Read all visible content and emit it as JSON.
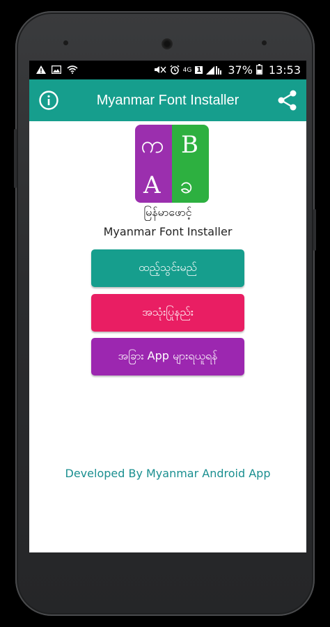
{
  "status_bar": {
    "battery_percent": "37%",
    "time": "13:53",
    "network_type": "4G",
    "sim_slot": "1",
    "icons": [
      "warning-icon",
      "image-icon",
      "wifi-icon",
      "mute-icon",
      "alarm-icon",
      "signal-icon",
      "battery-icon"
    ]
  },
  "app_bar": {
    "title": "Myanmar Font Installer",
    "left_icon": "info-icon",
    "right_icon": "share-icon",
    "color": "#169e8d"
  },
  "logo": {
    "top_left": "က",
    "top_right": "B",
    "bottom_left": "A",
    "bottom_right": "ခ",
    "left_color": "#9b2fae",
    "right_color": "#2db040"
  },
  "brand": {
    "name_mm": "မြန်မာဖောင့်",
    "name_en": "Myanmar Font Installer"
  },
  "buttons": {
    "install": {
      "label": "ထည့်သွင်းမည်",
      "color": "#169e8d"
    },
    "how_to_use": {
      "label": "အသုံးပြုနည်း",
      "color": "#e91e63"
    },
    "other_apps": {
      "label": "အခြား App များရယူရန်",
      "color": "#9c27b0"
    }
  },
  "footer": {
    "developer_text": "Developed By Myanmar Android App"
  }
}
